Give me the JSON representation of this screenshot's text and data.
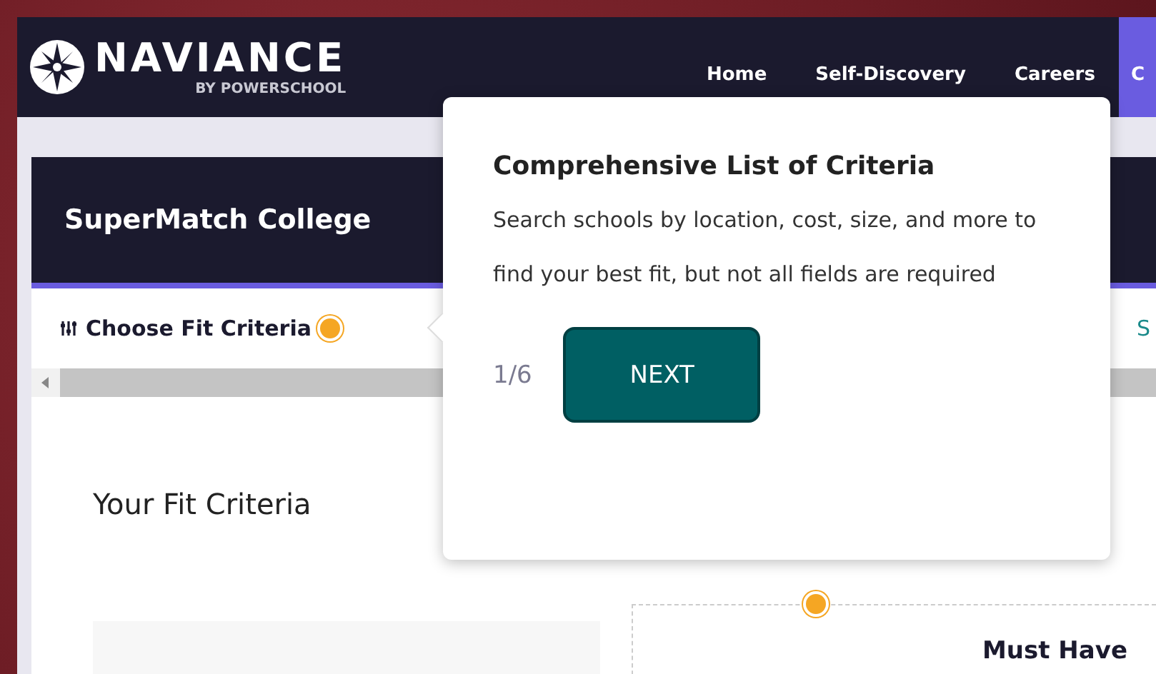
{
  "brand": {
    "name": "NAVIANCE",
    "tagline": "BY POWERSCHOOL"
  },
  "nav": [
    {
      "label": "Home",
      "selected": false
    },
    {
      "label": "Self-Discovery",
      "selected": false
    },
    {
      "label": "Careers",
      "selected": false
    },
    {
      "label": "C",
      "selected": true
    }
  ],
  "page": {
    "title": "SuperMatch College",
    "step": "Choose Fit Criteria",
    "step_next": "S",
    "section_title": "Your Fit Criteria",
    "panel_title": "Must Have"
  },
  "tour": {
    "title": "Comprehensive List of Criteria",
    "body": "Search schools by location, cost, size, and more to find your best fit, but not all fields are required",
    "progress": "1/6",
    "button": "NEXT"
  }
}
